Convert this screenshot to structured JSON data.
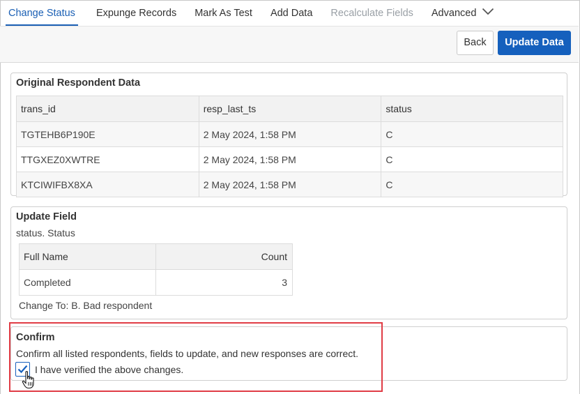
{
  "tabs": [
    {
      "label": "Change Status",
      "state": "active"
    },
    {
      "label": "Expunge Records",
      "state": "normal"
    },
    {
      "label": "Mark As Test",
      "state": "normal"
    },
    {
      "label": "Add Data",
      "state": "normal"
    },
    {
      "label": "Recalculate Fields",
      "state": "disabled"
    },
    {
      "label": "Advanced",
      "state": "normal",
      "icon": "chevron-down-icon"
    }
  ],
  "toolbar": {
    "back_label": "Back",
    "update_label": "Update Data"
  },
  "original": {
    "title": "Original Respondent Data",
    "columns": [
      "trans_id",
      "resp_last_ts",
      "status"
    ],
    "rows": [
      [
        "TGTEHB6P190E",
        "2 May 2024, 1:58 PM",
        "C"
      ],
      [
        "TTGXEZ0XWTRE",
        "2 May 2024, 1:58 PM",
        "C"
      ],
      [
        "KTCIWIFBX8XA",
        "2 May 2024, 1:58 PM",
        "C"
      ]
    ]
  },
  "update_field": {
    "title": "Update Field",
    "field_name": "status. Status",
    "columns": [
      "Full Name",
      "Count"
    ],
    "rows": [
      [
        "Completed",
        "3"
      ]
    ],
    "change_to": "Change To: B. Bad respondent"
  },
  "confirm": {
    "title": "Confirm",
    "description": "Confirm all listed respondents, fields to update, and new responses are correct.",
    "checkbox_label": "I have verified the above changes.",
    "checked": true
  },
  "colors": {
    "accent": "#1560bd",
    "highlight": "#e03c45"
  }
}
